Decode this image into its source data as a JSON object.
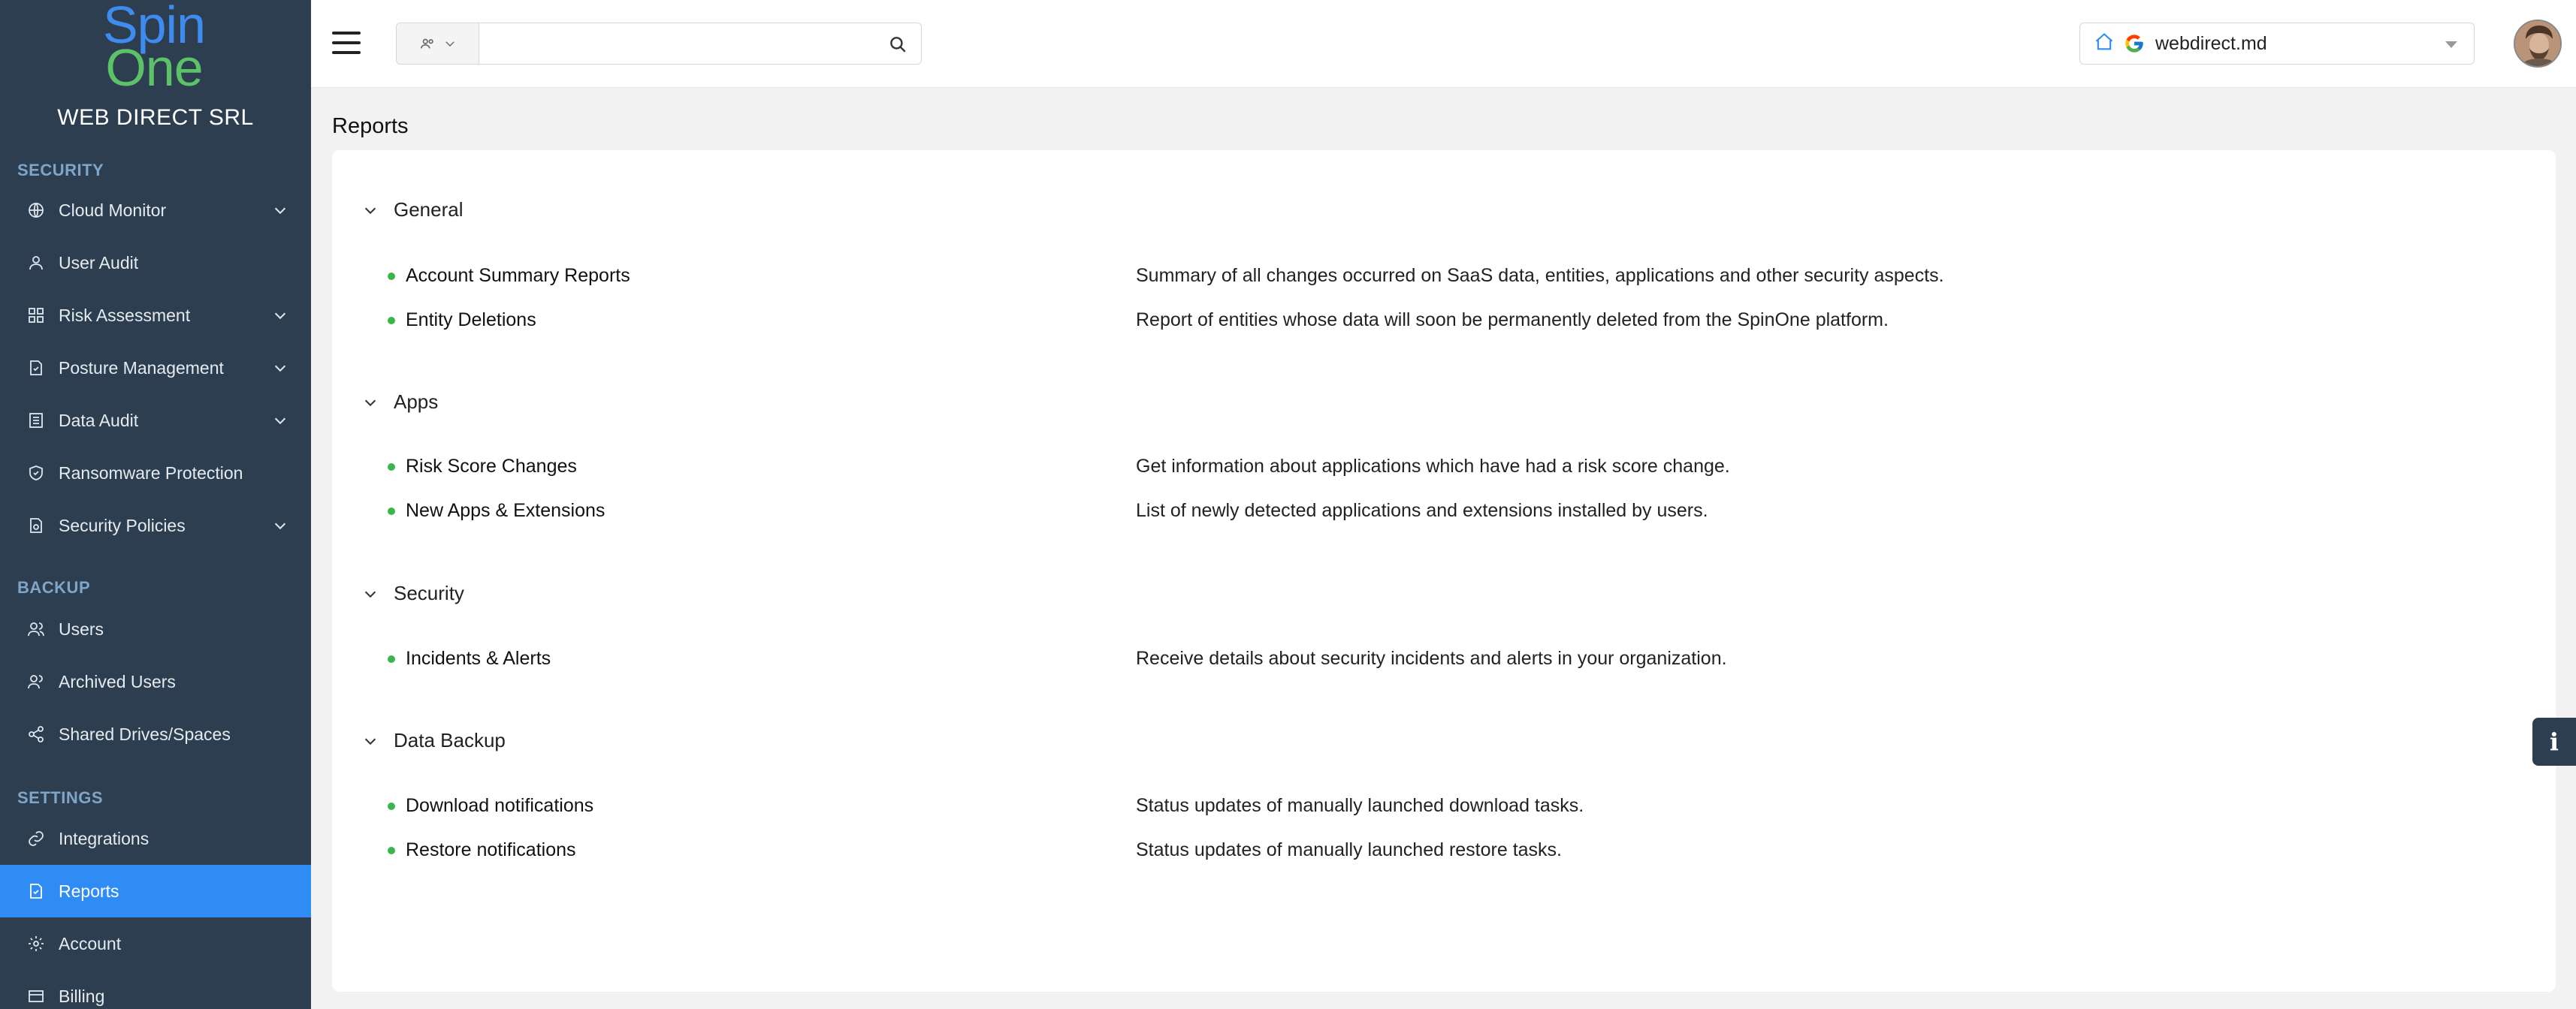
{
  "brand": {
    "logo_line1": "Spin",
    "logo_line2": "One",
    "company": "WEB DIRECT SRL"
  },
  "sidebar": {
    "sections": [
      {
        "title": "SECURITY",
        "items": [
          {
            "label": "Cloud Monitor",
            "icon": "globe-icon",
            "expandable": true
          },
          {
            "label": "User Audit",
            "icon": "user-icon",
            "expandable": false
          },
          {
            "label": "Risk Assessment",
            "icon": "grid-icon",
            "expandable": true
          },
          {
            "label": "Posture Management",
            "icon": "document-check-icon",
            "expandable": true
          },
          {
            "label": "Data Audit",
            "icon": "list-document-icon",
            "expandable": true
          },
          {
            "label": "Ransomware Protection",
            "icon": "shield-icon",
            "expandable": false
          },
          {
            "label": "Security Policies",
            "icon": "policy-icon",
            "expandable": true
          }
        ]
      },
      {
        "title": "BACKUP",
        "items": [
          {
            "label": "Users",
            "icon": "users-icon",
            "expandable": false
          },
          {
            "label": "Archived Users",
            "icon": "archived-users-icon",
            "expandable": false
          },
          {
            "label": "Shared Drives/Spaces",
            "icon": "share-icon",
            "expandable": false
          }
        ]
      },
      {
        "title": "SETTINGS",
        "items": [
          {
            "label": "Integrations",
            "icon": "link-icon",
            "expandable": false
          },
          {
            "label": "Reports",
            "icon": "report-icon",
            "expandable": false,
            "active": true
          },
          {
            "label": "Account",
            "icon": "gear-icon",
            "expandable": false
          },
          {
            "label": "Billing",
            "icon": "billing-icon",
            "expandable": false
          }
        ]
      }
    ]
  },
  "topbar": {
    "search_placeholder": "",
    "domain": "webdirect.md"
  },
  "page": {
    "title": "Reports"
  },
  "report_groups": [
    {
      "title": "General",
      "reports": [
        {
          "name": "Account Summary Reports",
          "description": "Summary of all changes occurred on SaaS data, entities, applications and other security aspects."
        },
        {
          "name": "Entity Deletions",
          "description": "Report of entities whose data will soon be permanently deleted from the SpinOne platform."
        }
      ]
    },
    {
      "title": "Apps",
      "reports": [
        {
          "name": "Risk Score Changes",
          "description": "Get information about applications which have had a risk score change."
        },
        {
          "name": "New Apps & Extensions",
          "description": "List of newly detected applications and extensions installed by users."
        }
      ]
    },
    {
      "title": "Security",
      "reports": [
        {
          "name": "Incidents & Alerts",
          "description": "Receive details about security incidents and alerts in your organization."
        }
      ]
    },
    {
      "title": "Data Backup",
      "reports": [
        {
          "name": "Download notifications",
          "description": "Status updates of manually launched download tasks."
        },
        {
          "name": "Restore notifications",
          "description": "Status updates of manually launched restore tasks."
        }
      ]
    }
  ],
  "colors": {
    "sidebar_bg": "#2d3e50",
    "active_item": "#2f8cf4",
    "bullet": "#3cb54a",
    "logo_blue": "#3f8cf0",
    "logo_green": "#5cc267"
  }
}
